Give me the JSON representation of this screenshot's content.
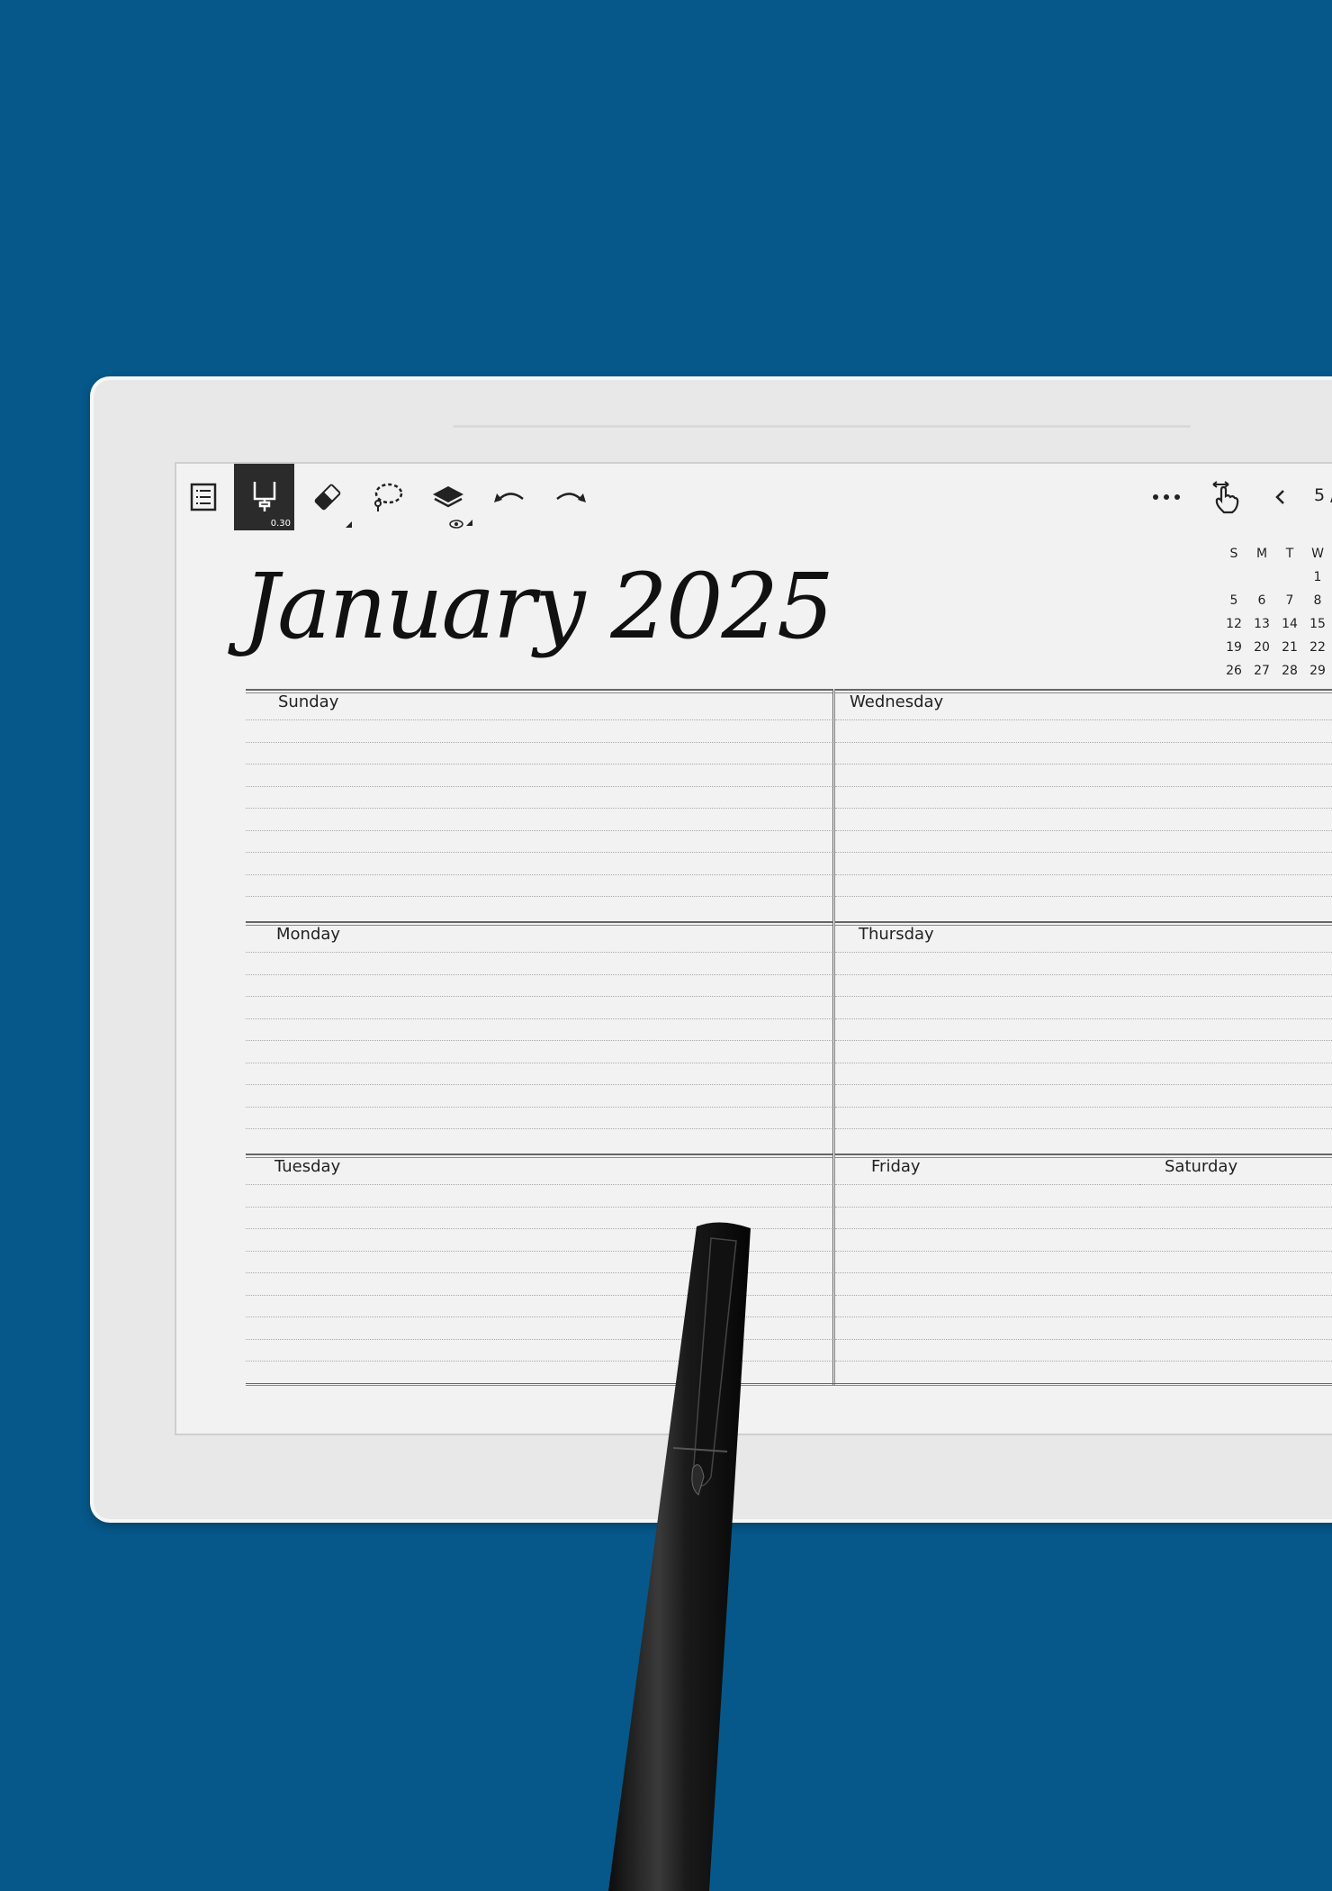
{
  "colors": {
    "background": "#06588a",
    "screen": "#f2f2f2",
    "toolbar_active": "#2b2b2b"
  },
  "toolbar": {
    "left": [
      {
        "icon": "table-of-contents-icon"
      },
      {
        "icon": "pen-icon",
        "active": true,
        "size": "0.30"
      },
      {
        "icon": "eraser-icon"
      },
      {
        "icon": "lasso-icon"
      },
      {
        "icon": "layers-icon"
      },
      {
        "icon": "undo-icon"
      },
      {
        "icon": "redo-icon"
      }
    ],
    "right": [
      {
        "icon": "more-icon"
      },
      {
        "icon": "touch-gesture-icon"
      },
      {
        "icon": "chevron-left-icon"
      }
    ],
    "page": "5 /"
  },
  "planner": {
    "title": "January 2025",
    "mini_calendar": {
      "headers": [
        "S",
        "M",
        "T",
        "W"
      ],
      "rows": [
        [
          "",
          "",
          "",
          "1"
        ],
        [
          "5",
          "6",
          "7",
          "8"
        ],
        [
          "12",
          "13",
          "14",
          "15"
        ],
        [
          "19",
          "20",
          "21",
          "22"
        ],
        [
          "26",
          "27",
          "28",
          "29"
        ]
      ]
    },
    "days": [
      "Sunday",
      "Monday",
      "Tuesday",
      "Wednesday",
      "Thursday",
      "Friday",
      "Saturday"
    ]
  }
}
